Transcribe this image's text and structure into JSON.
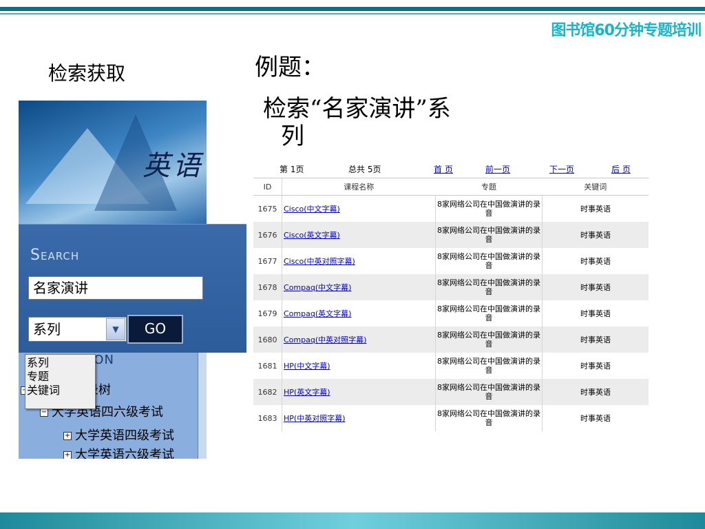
{
  "slide": {
    "course_title": "图书馆60分钟专题培训",
    "section_label": "检索获取",
    "example_title": "例题：",
    "task_line1": "检索“名家演讲”系",
    "task_line2": "列"
  },
  "left_panel": {
    "banner_text": "英语",
    "search_heading": "Search",
    "search_value": "名家演讲",
    "select_value": "系列",
    "go_label": "GO",
    "dropdown_options": [
      "系列",
      "专题",
      "关键词"
    ],
    "nav_header": "ION",
    "tree": [
      {
        "label": "目录树"
      },
      {
        "label": "大学英语四六级考试"
      },
      {
        "label": "大学英语四级考试"
      },
      {
        "label": "大学英语六级考试"
      }
    ]
  },
  "results": {
    "pager": {
      "page_label": "第 1页",
      "total_label": "总共 5页",
      "first": "首 页",
      "prev": "前一页",
      "next": "下一页",
      "last": "后 页"
    },
    "columns": [
      "ID",
      "课程名称",
      "专题",
      "关键词"
    ],
    "rows": [
      {
        "id": "1675",
        "name": "Cisco(中文字幕)",
        "topic": "8家网络公司在中国做演讲的录音",
        "keyword": "时事英语"
      },
      {
        "id": "1676",
        "name": "Cisco(英文字幕)",
        "topic": "8家网络公司在中国做演讲的录音",
        "keyword": "时事英语"
      },
      {
        "id": "1677",
        "name": "Cisco(中英对照字幕)",
        "topic": "8家网络公司在中国做演讲的录音",
        "keyword": "时事英语"
      },
      {
        "id": "1678",
        "name": "Compaq(中文字幕)",
        "topic": "8家网络公司在中国做演讲的录音",
        "keyword": "时事英语"
      },
      {
        "id": "1679",
        "name": "Compaq(英文字幕)",
        "topic": "8家网络公司在中国做演讲的录音",
        "keyword": "时事英语"
      },
      {
        "id": "1680",
        "name": "Compaq(中英对照字幕)",
        "topic": "8家网络公司在中国做演讲的录音",
        "keyword": "时事英语"
      },
      {
        "id": "1681",
        "name": "HP(中文字幕)",
        "topic": "8家网络公司在中国做演讲的录音",
        "keyword": "时事英语"
      },
      {
        "id": "1682",
        "name": "HP(英文字幕)",
        "topic": "8家网络公司在中国做演讲的录音",
        "keyword": "时事英语"
      },
      {
        "id": "1683",
        "name": "HP(中英对照字幕)",
        "topic": "8家网络公司在中国做演讲的录音",
        "keyword": "时事英语"
      }
    ]
  },
  "colors": {
    "teal_accent": "#0e6f80",
    "course_title": "#18b4c8",
    "link": "#0000cc",
    "search_panel": "#2d5c9b"
  }
}
